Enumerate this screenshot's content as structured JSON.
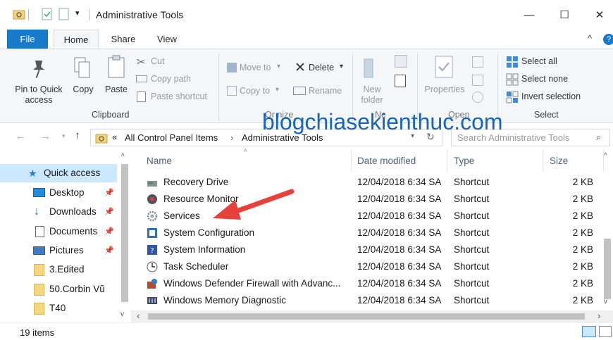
{
  "window": {
    "title": "Administrative Tools",
    "minimize": "—",
    "maximize": "☐",
    "close": "✕"
  },
  "tabs": {
    "file": "File",
    "home": "Home",
    "share": "Share",
    "view": "View"
  },
  "ribbon": {
    "pin_to_quick_access": "Pin to Quick access",
    "copy": "Copy",
    "paste": "Paste",
    "cut": "Cut",
    "copy_path": "Copy path",
    "paste_shortcut": "Paste shortcut",
    "clipboard_group": "Clipboard",
    "move_to": "Move to",
    "copy_to": "Copy to",
    "delete": "Delete",
    "rename": "Rename",
    "organize_group": "Or   nize",
    "new_folder": "New folder",
    "new_group": "Ne",
    "properties": "Properties",
    "open_group": "Open",
    "select_all": "Select all",
    "select_none": "Select none",
    "invert_selection": "Invert selection",
    "select_group": "Select"
  },
  "address": {
    "breadcrumb_prefix": "«",
    "crumb1": "All Control Panel Items",
    "crumb2": "Administrative Tools",
    "search_placeholder": "Search Administrative Tools"
  },
  "nav": {
    "quick_access": "Quick access",
    "items": [
      {
        "label": "Desktop",
        "pinned": true
      },
      {
        "label": "Downloads",
        "pinned": true
      },
      {
        "label": "Documents",
        "pinned": true
      },
      {
        "label": "Pictures",
        "pinned": true
      },
      {
        "label": "3.Edited",
        "pinned": false
      },
      {
        "label": "50.Corbin Vũ",
        "pinned": false
      },
      {
        "label": "T40",
        "pinned": false
      }
    ]
  },
  "columns": {
    "name": "Name",
    "date": "Date modified",
    "type": "Type",
    "size": "Size"
  },
  "files": [
    {
      "name": "Recovery Drive",
      "date": "12/04/2018 6:34 SA",
      "type": "Shortcut",
      "size": "2 KB"
    },
    {
      "name": "Resource Monitor",
      "date": "12/04/2018 6:34 SA",
      "type": "Shortcut",
      "size": "2 KB"
    },
    {
      "name": "Services",
      "date": "12/04/2018 6:34 SA",
      "type": "Shortcut",
      "size": "2 KB"
    },
    {
      "name": "System Configuration",
      "date": "12/04/2018 6:34 SA",
      "type": "Shortcut",
      "size": "2 KB"
    },
    {
      "name": "System Information",
      "date": "12/04/2018 6:34 SA",
      "type": "Shortcut",
      "size": "2 KB"
    },
    {
      "name": "Task Scheduler",
      "date": "12/04/2018 6:34 SA",
      "type": "Shortcut",
      "size": "2 KB"
    },
    {
      "name": "Windows Defender Firewall with Advanc...",
      "date": "12/04/2018 6:34 SA",
      "type": "Shortcut",
      "size": "2 KB"
    },
    {
      "name": "Windows Memory Diagnostic",
      "date": "12/04/2018 6:34 SA",
      "type": "Shortcut",
      "size": "2 KB"
    }
  ],
  "status": {
    "item_count": "19 items"
  },
  "watermark": "blogchiasekienthuc.com",
  "colors": {
    "accent": "#1979ca",
    "arrow": "#e8413c",
    "watermark": "#1565c0"
  }
}
